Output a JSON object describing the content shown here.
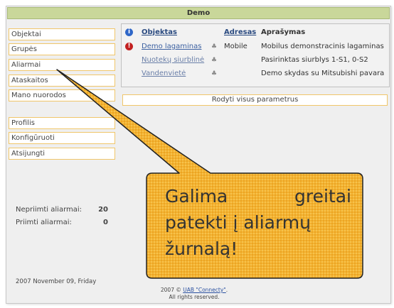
{
  "header": {
    "title": "Demo"
  },
  "sidebar": {
    "menu": [
      "Objektai",
      "Grupės",
      "Aliarmai",
      "Ataskaitos",
      "Mano nuorodos"
    ],
    "menu2": [
      "Profilis",
      "Konfigūruoti",
      "Atsijungti"
    ],
    "stats": [
      {
        "label": "Nepriimti aliarmai:",
        "value": "20"
      },
      {
        "label": "Priimti aliarmai:",
        "value": "0"
      }
    ],
    "date": "2007 November 09, Friday"
  },
  "table": {
    "headers": {
      "object": "Objektas",
      "address": "Adresas",
      "description": "Aprašymas"
    },
    "rows": [
      {
        "object": "Demo lagaminas",
        "address": "Mobile",
        "description": "Mobilus demonstracinis lagaminas",
        "status": "alert"
      },
      {
        "object": "Nuotekų siurblinė",
        "address": "",
        "description": "Pasirinktas siurblys 1-S1, 0-S2",
        "status": "none"
      },
      {
        "object": "Vandenvietė",
        "address": "",
        "description": "Demo skydas su Mitsubishi pavara",
        "status": "none"
      }
    ]
  },
  "params_button": "Rodyti visus parametrus",
  "footer": {
    "line1_prefix": "2007 © ",
    "link": "UAB \"Connecty\"",
    "line1_suffix": ".",
    "line2": "All rights reserved."
  },
  "callout": {
    "line1a": "Galima",
    "line1b": "greitai",
    "line2": "patekti į aliarmų",
    "line3": "žurnalą!"
  },
  "colors": {
    "accent": "#c9d79a",
    "menu_border": "#f0c66a",
    "callout_fill": "#f3b230",
    "link": "#3a5fa0"
  }
}
